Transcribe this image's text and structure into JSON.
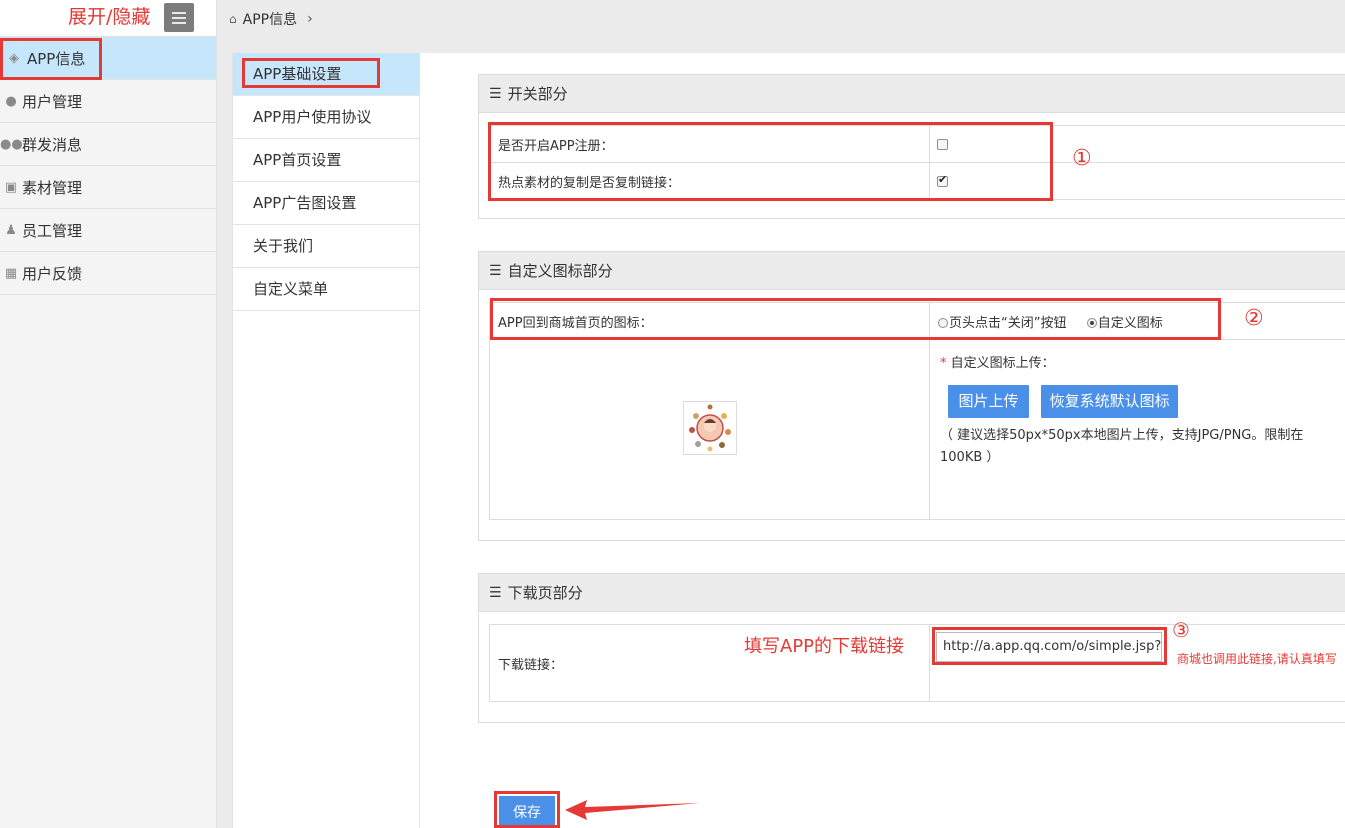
{
  "sidebar": {
    "toggle_annotation": "展开/隐藏",
    "items": [
      {
        "label": "APP信息",
        "icon": "app-icon",
        "active": true
      },
      {
        "label": "用户管理",
        "icon": "user-icon"
      },
      {
        "label": "群发消息",
        "icon": "users-group-icon"
      },
      {
        "label": "素材管理",
        "icon": "image-icon"
      },
      {
        "label": "员工管理",
        "icon": "staff-icon"
      },
      {
        "label": "用户反馈",
        "icon": "grid-icon"
      }
    ]
  },
  "breadcrumb": {
    "home_icon": "home-icon",
    "current": "APP信息",
    "chevron": "›"
  },
  "subnav": {
    "items": [
      {
        "label": "APP基础设置",
        "active": true
      },
      {
        "label": "APP用户使用协议"
      },
      {
        "label": "APP首页设置"
      },
      {
        "label": "APP广告图设置"
      },
      {
        "label": "关于我们"
      },
      {
        "label": "自定义菜单"
      }
    ]
  },
  "switch_section": {
    "title": "开关部分",
    "rows": [
      {
        "label": "是否开启APP注册：",
        "checked": false
      },
      {
        "label": "热点素材的复制是否复制链接：",
        "checked": true
      }
    ],
    "marker": "①"
  },
  "icon_section": {
    "title": "自定义图标部分",
    "label": "APP回到商城首页的图标：",
    "options": [
      {
        "label": "页头点击“关闭”按钮",
        "selected": false
      },
      {
        "label": "自定义图标",
        "selected": true
      }
    ],
    "marker": "②",
    "upload_required_mark": "*",
    "upload_label": "自定义图标上传：",
    "upload_button": "图片上传",
    "restore_button": "恢复系统默认图标",
    "hint": "（ 建议选择50px*50px本地图片上传，支持JPG/PNG。限制在100KB ）"
  },
  "download_section": {
    "title": "下载页部分",
    "label": "下载链接：",
    "annotation": "填写APP的下载链接",
    "input_value": "http://a.app.qq.com/o/simple.jsp?p",
    "marker": "③",
    "note": "商城也调用此链接,请认真填写"
  },
  "save_button": "保存",
  "colors": {
    "accent_blue": "#4a90e8",
    "annotation_red": "#e53935",
    "active_bg": "#c5e6fb"
  }
}
